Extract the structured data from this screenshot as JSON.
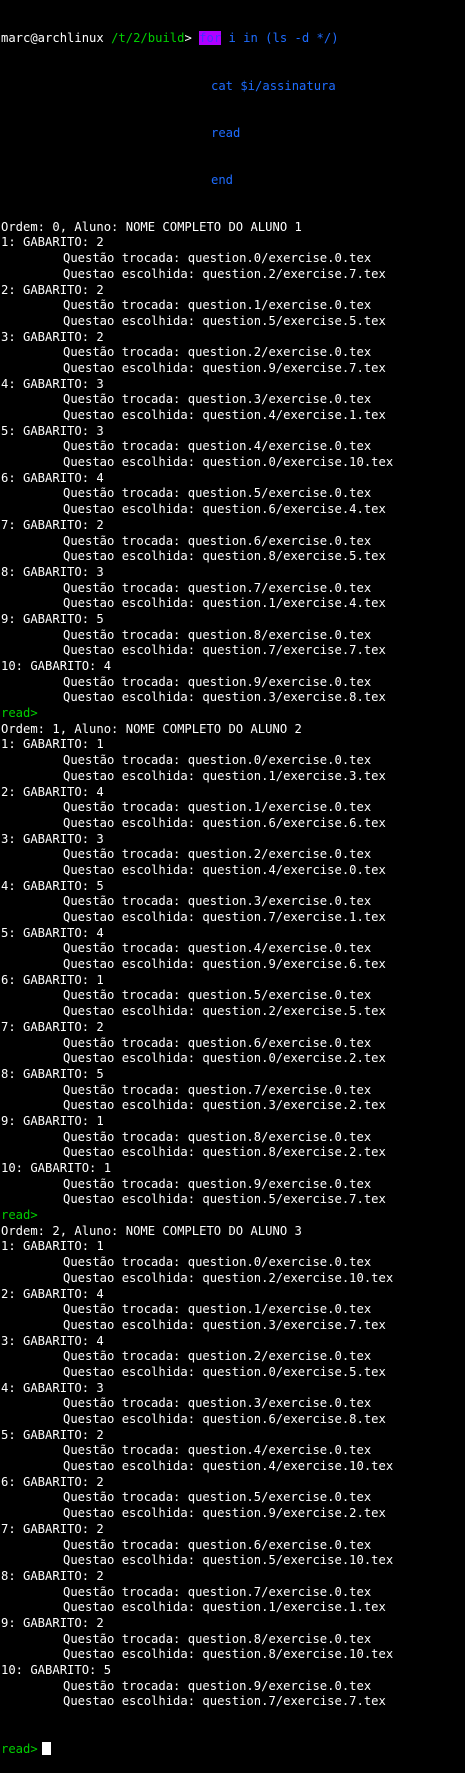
{
  "prompt": {
    "user_host": "marc@archlinux",
    "path": "/t/2/build",
    "symbol": ">",
    "for_kw": "for",
    "cmd_rest": " i in (ls -d */)",
    "line2": "cat $i/assinatura",
    "line3": "read",
    "line4": "end"
  },
  "colors": {
    "background": "#000000",
    "text": "#ffffff",
    "green": "#00d000",
    "blue": "#1e6cff",
    "highlight": "#b000ff"
  },
  "read_prompt": "read>",
  "blocks": [
    {
      "header": "Ordem: 0, Aluno: NOME COMPLETO DO ALUNO 1",
      "items": [
        {
          "g": "1: GABARITO: 2",
          "t": "Questão trocada: question.0/exercise.0.tex",
          "e": "Questao escolhida: question.2/exercise.7.tex"
        },
        {
          "g": "2: GABARITO: 2",
          "t": "Questão trocada: question.1/exercise.0.tex",
          "e": "Questao escolhida: question.5/exercise.5.tex"
        },
        {
          "g": "3: GABARITO: 2",
          "t": "Questão trocada: question.2/exercise.0.tex",
          "e": "Questao escolhida: question.9/exercise.7.tex"
        },
        {
          "g": "4: GABARITO: 3",
          "t": "Questão trocada: question.3/exercise.0.tex",
          "e": "Questao escolhida: question.4/exercise.1.tex"
        },
        {
          "g": "5: GABARITO: 3",
          "t": "Questão trocada: question.4/exercise.0.tex",
          "e": "Questao escolhida: question.0/exercise.10.tex"
        },
        {
          "g": "6: GABARITO: 4",
          "t": "Questão trocada: question.5/exercise.0.tex",
          "e": "Questao escolhida: question.6/exercise.4.tex"
        },
        {
          "g": "7: GABARITO: 2",
          "t": "Questão trocada: question.6/exercise.0.tex",
          "e": "Questao escolhida: question.8/exercise.5.tex"
        },
        {
          "g": "8: GABARITO: 3",
          "t": "Questão trocada: question.7/exercise.0.tex",
          "e": "Questao escolhida: question.1/exercise.4.tex"
        },
        {
          "g": "9: GABARITO: 5",
          "t": "Questão trocada: question.8/exercise.0.tex",
          "e": "Questao escolhida: question.7/exercise.7.tex"
        },
        {
          "g": "10: GABARITO: 4",
          "t": "Questão trocada: question.9/exercise.0.tex",
          "e": "Questao escolhida: question.3/exercise.8.tex"
        }
      ]
    },
    {
      "header": "Ordem: 1, Aluno: NOME COMPLETO DO ALUNO 2",
      "items": [
        {
          "g": "1: GABARITO: 1",
          "t": "Questão trocada: question.0/exercise.0.tex",
          "e": "Questao escolhida: question.1/exercise.3.tex"
        },
        {
          "g": "2: GABARITO: 4",
          "t": "Questão trocada: question.1/exercise.0.tex",
          "e": "Questao escolhida: question.6/exercise.6.tex"
        },
        {
          "g": "3: GABARITO: 3",
          "t": "Questão trocada: question.2/exercise.0.tex",
          "e": "Questao escolhida: question.4/exercise.0.tex"
        },
        {
          "g": "4: GABARITO: 5",
          "t": "Questão trocada: question.3/exercise.0.tex",
          "e": "Questao escolhida: question.7/exercise.1.tex"
        },
        {
          "g": "5: GABARITO: 4",
          "t": "Questão trocada: question.4/exercise.0.tex",
          "e": "Questao escolhida: question.9/exercise.6.tex"
        },
        {
          "g": "6: GABARITO: 1",
          "t": "Questão trocada: question.5/exercise.0.tex",
          "e": "Questao escolhida: question.2/exercise.5.tex"
        },
        {
          "g": "7: GABARITO: 2",
          "t": "Questão trocada: question.6/exercise.0.tex",
          "e": "Questao escolhida: question.0/exercise.2.tex"
        },
        {
          "g": "8: GABARITO: 5",
          "t": "Questão trocada: question.7/exercise.0.tex",
          "e": "Questao escolhida: question.3/exercise.2.tex"
        },
        {
          "g": "9: GABARITO: 1",
          "t": "Questão trocada: question.8/exercise.0.tex",
          "e": "Questao escolhida: question.8/exercise.2.tex"
        },
        {
          "g": "10: GABARITO: 1",
          "t": "Questão trocada: question.9/exercise.0.tex",
          "e": "Questao escolhida: question.5/exercise.7.tex"
        }
      ]
    },
    {
      "header": "Ordem: 2, Aluno: NOME COMPLETO DO ALUNO 3",
      "items": [
        {
          "g": "1: GABARITO: 1",
          "t": "Questão trocada: question.0/exercise.0.tex",
          "e": "Questao escolhida: question.2/exercise.10.tex"
        },
        {
          "g": "2: GABARITO: 4",
          "t": "Questão trocada: question.1/exercise.0.tex",
          "e": "Questao escolhida: question.3/exercise.7.tex"
        },
        {
          "g": "3: GABARITO: 4",
          "t": "Questão trocada: question.2/exercise.0.tex",
          "e": "Questao escolhida: question.0/exercise.5.tex"
        },
        {
          "g": "4: GABARITO: 3",
          "t": "Questão trocada: question.3/exercise.0.tex",
          "e": "Questao escolhida: question.6/exercise.8.tex"
        },
        {
          "g": "5: GABARITO: 2",
          "t": "Questão trocada: question.4/exercise.0.tex",
          "e": "Questao escolhida: question.4/exercise.10.tex"
        },
        {
          "g": "6: GABARITO: 2",
          "t": "Questão trocada: question.5/exercise.0.tex",
          "e": "Questao escolhida: question.9/exercise.2.tex"
        },
        {
          "g": "7: GABARITO: 2",
          "t": "Questão trocada: question.6/exercise.0.tex",
          "e": "Questao escolhida: question.5/exercise.10.tex"
        },
        {
          "g": "8: GABARITO: 2",
          "t": "Questão trocada: question.7/exercise.0.tex",
          "e": "Questao escolhida: question.1/exercise.1.tex"
        },
        {
          "g": "9: GABARITO: 2",
          "t": "Questão trocada: question.8/exercise.0.tex",
          "e": "Questao escolhida: question.8/exercise.10.tex"
        },
        {
          "g": "10: GABARITO: 5",
          "t": "Questão trocada: question.9/exercise.0.tex",
          "e": "Questao escolhida: question.7/exercise.7.tex"
        }
      ]
    }
  ]
}
